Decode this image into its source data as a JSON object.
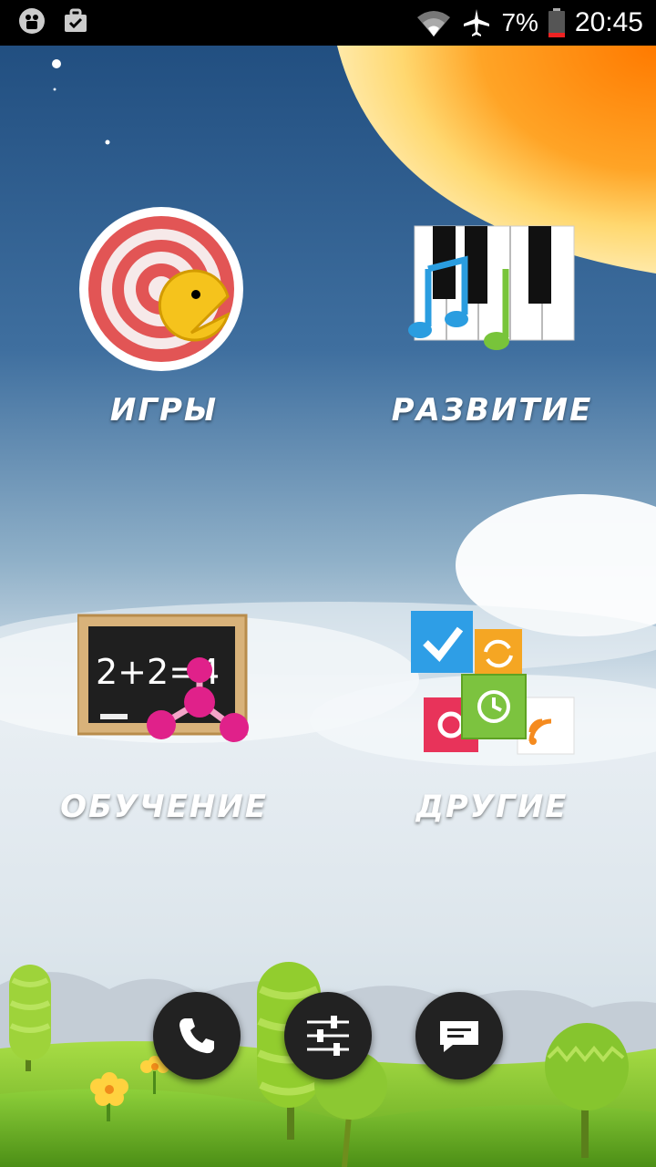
{
  "status_bar": {
    "battery_percent": "7%",
    "time": "20:45",
    "left_icons": [
      "android-debug-icon",
      "briefcase-check-icon"
    ],
    "right_icons": [
      "wifi-icon",
      "airplane-mode-icon",
      "battery-low-icon"
    ]
  },
  "apps": [
    {
      "label": "ИГРЫ",
      "icon": "target-pacman-icon"
    },
    {
      "label": "РАЗВИТИЕ",
      "icon": "piano-notes-icon"
    },
    {
      "label": "ОБУЧЕНИЕ",
      "icon": "chalkboard-molecule-icon"
    },
    {
      "label": "ДРУГИЕ",
      "icon": "tiles-icon"
    }
  ],
  "chalkboard_text": "2+2=4",
  "dock": [
    {
      "icon": "phone-icon"
    },
    {
      "icon": "settings-sliders-icon"
    },
    {
      "icon": "message-icon"
    }
  ],
  "colors": {
    "sky_top": "#1f4f82",
    "sun": "#ff8a00",
    "grass": "#8ccf2e",
    "dock_button": "#222222"
  }
}
